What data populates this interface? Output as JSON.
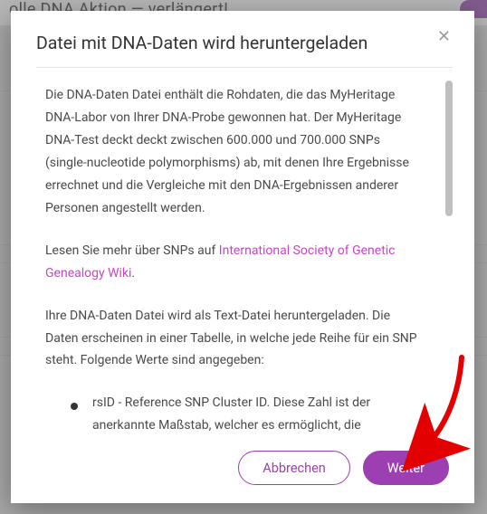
{
  "background": {
    "header_fragment": "olle DNA Aktion — verlängert!"
  },
  "modal": {
    "title": "Datei mit DNA-Daten wird heruntergeladen",
    "close_symbol": "✕",
    "paragraphs": {
      "p1": "Die DNA-Daten Datei enthält die Rohdaten, die das MyHeritage DNA-Labor von Ihrer DNA-Probe gewonnen hat. Der MyHeritage DNA-Test deckt deckt zwischen 600.000 und 700.000 SNPs (single-nucleotide polymorphisms) ab, mit denen Ihre Ergebnisse errechnet und die Vergleiche mit den DNA-Ergebnissen anderer Personen angestellt werden.",
      "p2_before_link": "Lesen Sie mehr über SNPs auf ",
      "p2_link": "International Society of Genetic Genealogy Wiki",
      "p2_after_link": ".",
      "p3": "Ihre DNA-Daten Datei wird als Text-Datei heruntergeladen. Die Daten erscheinen in einer Tabelle, in welche jede Reihe für ein SNP steht. Folgende Werte sind angegeben:",
      "bullet1": "rsID - Reference SNP Cluster ID. Diese Zahl ist der anerkannte Maßstab, welcher es ermöglicht, die Kenntnisse um SNPs zu managen, die durch"
    },
    "buttons": {
      "cancel": "Abbrechen",
      "next": "Weiter"
    }
  }
}
